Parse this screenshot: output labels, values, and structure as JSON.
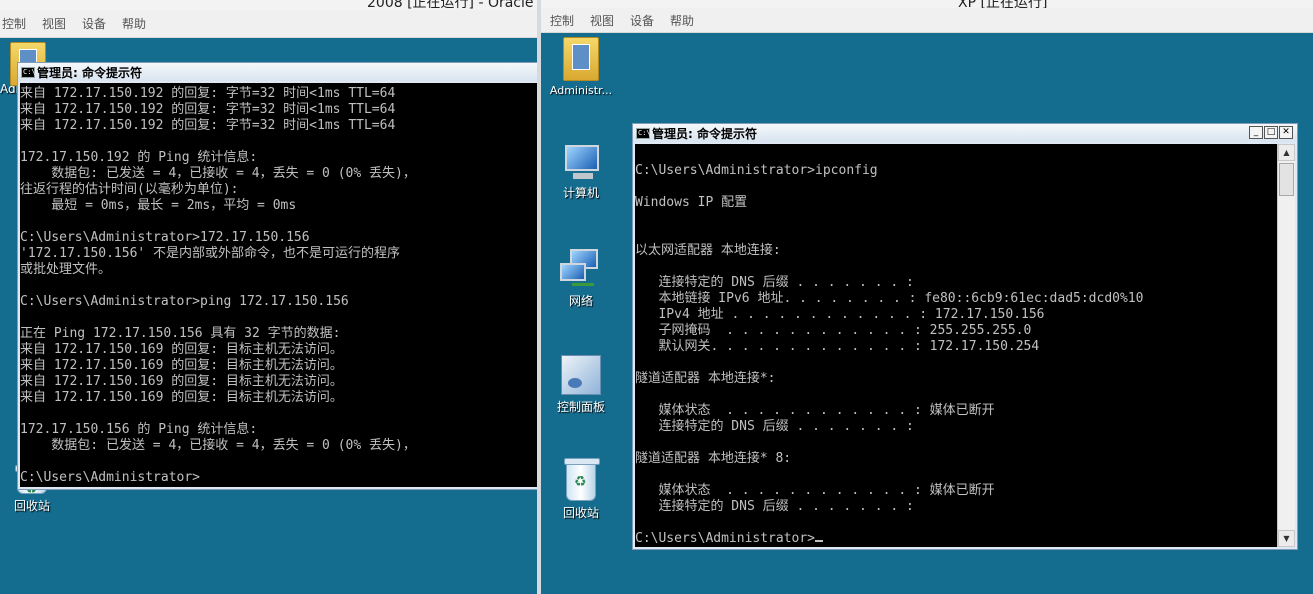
{
  "left_vm": {
    "title": "2008 [正在运行] - Oracle",
    "menu": [
      "控制",
      "视图",
      "设备",
      "帮助"
    ],
    "desktop_icons": [
      {
        "label": "Adm",
        "icon": "folder-icon"
      },
      {
        "label": "回收站",
        "icon": "recycle-bin-icon"
      }
    ],
    "cmd_window": {
      "title": "管理员: 命令提示符",
      "lines": [
        "来自 172.17.150.192 的回复: 字节=32 时间<1ms TTL=64",
        "来自 172.17.150.192 的回复: 字节=32 时间<1ms TTL=64",
        "来自 172.17.150.192 的回复: 字节=32 时间<1ms TTL=64",
        "",
        "172.17.150.192 的 Ping 统计信息:",
        "    数据包: 已发送 = 4，已接收 = 4，丢失 = 0 (0% 丢失)，",
        "往返行程的估计时间(以毫秒为单位):",
        "    最短 = 0ms，最长 = 2ms，平均 = 0ms",
        "",
        "C:\\Users\\Administrator>172.17.150.156",
        "'172.17.150.156' 不是内部或外部命令，也不是可运行的程序",
        "或批处理文件。",
        "",
        "C:\\Users\\Administrator>ping 172.17.150.156",
        "",
        "正在 Ping 172.17.150.156 具有 32 字节的数据:",
        "来自 172.17.150.169 的回复: 目标主机无法访问。",
        "来自 172.17.150.169 的回复: 目标主机无法访问。",
        "来自 172.17.150.169 的回复: 目标主机无法访问。",
        "来自 172.17.150.169 的回复: 目标主机无法访问。",
        "",
        "172.17.150.156 的 Ping 统计信息:",
        "    数据包: 已发送 = 4，已接收 = 4，丢失 = 0 (0% 丢失)，",
        "",
        "C:\\Users\\Administrator>"
      ]
    }
  },
  "right_vm": {
    "title": "XP [正在运行]",
    "menu": [
      "控制",
      "视图",
      "设备",
      "帮助"
    ],
    "desktop_icons": [
      {
        "label": "Administr...",
        "icon": "user-folder-icon"
      },
      {
        "label": "计算机",
        "icon": "computer-icon"
      },
      {
        "label": "网络",
        "icon": "network-icon"
      },
      {
        "label": "控制面板",
        "icon": "control-panel-icon"
      },
      {
        "label": "回收站",
        "icon": "recycle-bin-icon"
      }
    ],
    "cmd_window": {
      "title": "管理员: 命令提示符",
      "buttons": {
        "minimize": "_",
        "maximize": "□",
        "close": "✕"
      },
      "scroll_up": "▲",
      "scroll_down": "▼",
      "lines": [
        "",
        "C:\\Users\\Administrator>ipconfig",
        "",
        "Windows IP 配置",
        "",
        "",
        "以太网适配器 本地连接:",
        "",
        "   连接特定的 DNS 后缀 . . . . . . . :",
        "   本地链接 IPv6 地址. . . . . . . . : fe80::6cb9:61ec:dad5:dcd0%10",
        "   IPv4 地址 . . . . . . . . . . . . : 172.17.150.156",
        "   子网掩码  . . . . . . . . . . . . : 255.255.255.0",
        "   默认网关. . . . . . . . . . . . . : 172.17.150.254",
        "",
        "隧道适配器 本地连接*:",
        "",
        "   媒体状态  . . . . . . . . . . . . : 媒体已断开",
        "   连接特定的 DNS 后缀 . . . . . . . :",
        "",
        "隧道适配器 本地连接* 8:",
        "",
        "   媒体状态  . . . . . . . . . . . . : 媒体已断开",
        "   连接特定的 DNS 后缀 . . . . . . . :",
        "",
        "C:\\Users\\Administrator>"
      ]
    }
  }
}
